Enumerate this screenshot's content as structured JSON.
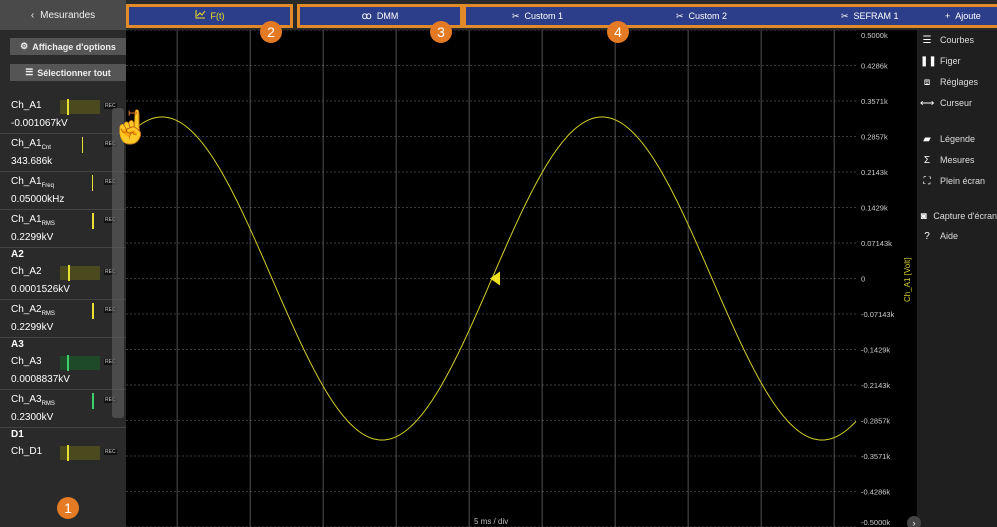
{
  "topbar": {
    "back_label": "Mesurandes",
    "tabs": [
      {
        "label": "F(t)",
        "icon": "chart-icon"
      },
      {
        "label": "DMM",
        "icon": "dmm-icon"
      }
    ],
    "group_tabs": [
      {
        "label": "Custom 1",
        "icon": "tools-icon"
      },
      {
        "label": "Custom 2",
        "icon": "tools-icon"
      },
      {
        "label": "SEFRAM 1",
        "icon": "tools-icon"
      },
      {
        "label": "Ajoute",
        "icon": "plus-icon"
      }
    ]
  },
  "left": {
    "options_label": "Affichage d'options",
    "select_all_label": "Sélectionner tout",
    "channels": [
      {
        "name": "Ch_A1",
        "sub": "",
        "value": "-0.001067kV",
        "rec": "REC"
      },
      {
        "name": "Ch_A1",
        "sub": "Cnt",
        "value": "343.686k",
        "rec": "REC"
      },
      {
        "name": "Ch_A1",
        "sub": "Freq",
        "value": "0.05000kHz",
        "rec": "REC"
      },
      {
        "name": "Ch_A1",
        "sub": "RMS",
        "value": "0.2299kV",
        "rec": "REC"
      },
      {
        "name": "Ch_A2",
        "sub": "",
        "value": "0.0001526kV",
        "rec": "REC"
      },
      {
        "name": "Ch_A2",
        "sub": "RMS",
        "value": "0.2299kV",
        "rec": "REC"
      },
      {
        "name": "Ch_A3",
        "sub": "",
        "value": "0.0008837kV",
        "rec": "REC"
      },
      {
        "name": "Ch_A3",
        "sub": "RMS",
        "value": "0.2300kV",
        "rec": "REC"
      },
      {
        "name": "Ch_D1",
        "sub": "",
        "value": "",
        "rec": "REC"
      }
    ],
    "groups": [
      "A2",
      "A3",
      "D1"
    ]
  },
  "plot": {
    "y_axis_label": "Ch_A1 [Volt]",
    "x_div_label": "5 ms / div",
    "y_ticks": [
      "0.5000k",
      "0.4286k",
      "0.3571k",
      "0.2857k",
      "0.2143k",
      "0.1429k",
      "0.07143k",
      "0",
      "-0.07143k",
      "-0.1429k",
      "-0.2143k",
      "-0.2857k",
      "-0.3571k",
      "-0.4286k",
      "-0.5000k"
    ]
  },
  "chart_data": {
    "type": "line",
    "ylabel": "Ch_A1 [Volt]",
    "xlabel": "5 ms / div",
    "ylim": [
      -0.5,
      0.5
    ],
    "x_divisions": 10,
    "series": [
      {
        "name": "Ch_A1 [Volt]",
        "amplitude": 0.325,
        "frequency_hz": 50,
        "ms_per_div": 5,
        "color": "#d4cf2a"
      }
    ]
  },
  "right_menu": [
    {
      "label": "Courbes",
      "icon": "curves-icon"
    },
    {
      "label": "Figer",
      "icon": "pause-icon"
    },
    {
      "label": "Réglages",
      "icon": "settings-icon"
    },
    {
      "label": "Curseur",
      "icon": "cursor-icon"
    },
    {
      "label": "Légende",
      "icon": "legend-icon"
    },
    {
      "label": "Mesures",
      "icon": "sigma-icon"
    },
    {
      "label": "Plein écran",
      "icon": "fullscreen-icon"
    },
    {
      "label": "Capture d'écran",
      "icon": "camera-icon"
    },
    {
      "label": "Aide",
      "icon": "help-icon"
    }
  ],
  "badges": [
    "1",
    "2",
    "3",
    "4"
  ],
  "colors": {
    "tab_bg": "#2c3e8a",
    "tab_border": "#e08a2a",
    "trace": "#d4cf2a",
    "badge": "#e57a24"
  }
}
